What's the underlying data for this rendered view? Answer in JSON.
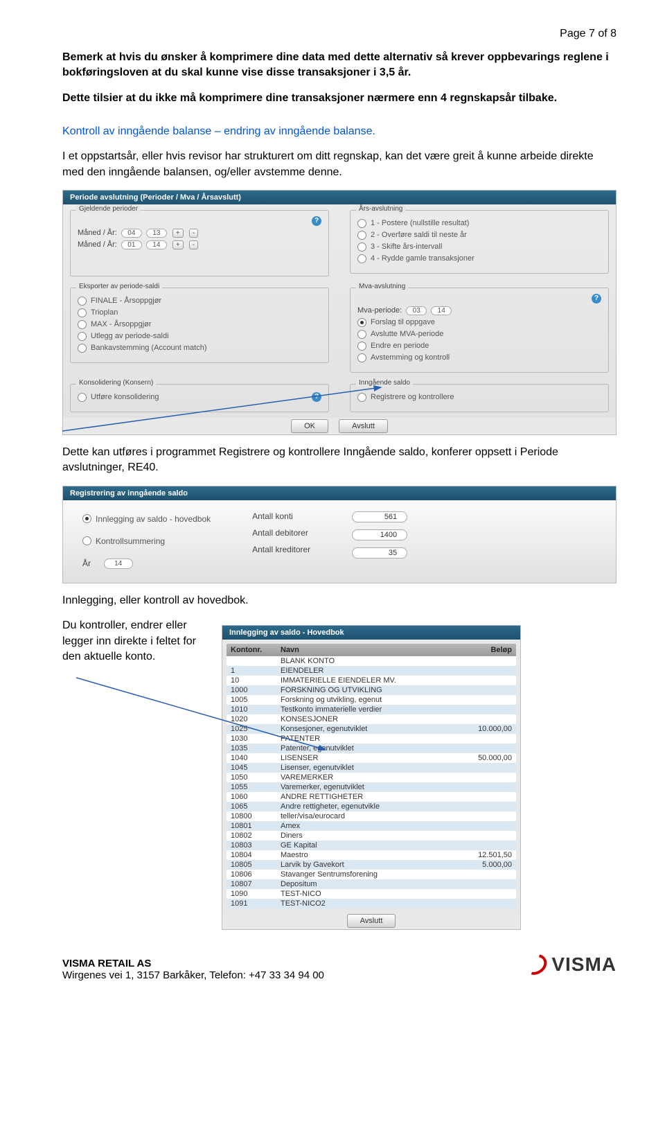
{
  "page_header": "Page 7 of 8",
  "intro1": "Bemerk at hvis du ønsker å komprimere dine data med dette alternativ så krever oppbevarings reglene i bokføringsloven at du skal kunne vise disse transaksjoner i 3,5 år.",
  "intro2": "Dette tilsier at du ikke må komprimere dine transaksjoner nærmere enn 4 regnskapsår tilbake.",
  "blue_heading": "Kontroll av inngående balanse – endring av inngående balanse.",
  "para1": "I et oppstartsår, eller hvis revisor har strukturert om ditt regnskap, kan det være greit å kunne arbeide direkte med den inngående balansen, og/eller avstemme denne.",
  "dlg1": {
    "title": "Periode avslutning (Perioder / Mva / Årsavslutt)",
    "gjeldende_label": "Gjeldende perioder",
    "maned_ar": "Måned / År:",
    "m1": "04",
    "y1": "13",
    "m2": "01",
    "y2": "14",
    "ars_label": "Års-avslutning",
    "ars_opts": [
      "1 - Postere (nullstille resultat)",
      "2 - Overføre saldi til neste år",
      "3 - Skifte års-intervall",
      "4 - Rydde gamle transaksjoner"
    ],
    "eksport_label": "Eksporter av periode-saldi",
    "eksport_opts": [
      "FINALE - Årsoppgjør",
      "Trioplan",
      "MAX - Årsoppgjør",
      "Utlegg av periode-saldi",
      "Bankavstemming (Account match)"
    ],
    "mva_label": "Mva-avslutning",
    "mva_periode": "Mva-periode:",
    "mva_m": "03",
    "mva_y": "14",
    "mva_opts": [
      "Forslag til oppgave",
      "Avslutte MVA-periode",
      "Endre en periode",
      "Avstemming og kontroll"
    ],
    "kons_label": "Konsolidering (Konsern)",
    "kons_opt": "Utføre konsolidering",
    "inng_label": "Inngående saldo",
    "inng_opt": "Registrere og kontrollere",
    "ok": "OK",
    "cancel": "Avslutt"
  },
  "para2": "Dette kan utføres i programmet Registrere og kontrollere Inngående saldo, konferer oppsett i Periode avslutninger, RE40.",
  "dlg2": {
    "title": "Registrering av inngående saldo",
    "opts": [
      "Innlegging av saldo - hovedbok",
      "Kontrollsummering"
    ],
    "ar_label": "År",
    "ar": "14",
    "antall_konti_label": "Antall konti",
    "antall_konti": "561",
    "antall_deb_label": "Antall debitorer",
    "antall_deb": "1400",
    "antall_kred_label": "Antall kreditorer",
    "antall_kred": "35"
  },
  "para3": "Innlegging, eller kontroll av hovedbok.",
  "para4": "Du kontroller, endrer eller legger inn direkte i feltet for den aktuelle konto.",
  "dlg3": {
    "title": "Innlegging av saldo - Hovedbok",
    "h1": "Kontonr.",
    "h2": "Navn",
    "h3": "Beløp",
    "rows": [
      {
        "n": "",
        "t": "BLANK KONTO",
        "b": ""
      },
      {
        "n": "1",
        "t": "EIENDELER",
        "b": ""
      },
      {
        "n": "10",
        "t": "IMMATERIELLE EIENDELER MV.",
        "b": ""
      },
      {
        "n": "1000",
        "t": "FORSKNING OG UTVIKLING",
        "b": ""
      },
      {
        "n": "1005",
        "t": "Forskning og utvikling, egenut",
        "b": ""
      },
      {
        "n": "1010",
        "t": "Testkonto immaterielle verdier",
        "b": ""
      },
      {
        "n": "1020",
        "t": "KONSESJONER",
        "b": ""
      },
      {
        "n": "1025",
        "t": "Konsesjoner, egenutviklet",
        "b": "10.000,00"
      },
      {
        "n": "1030",
        "t": "PATENTER",
        "b": ""
      },
      {
        "n": "1035",
        "t": "Patenter, egenutviklet",
        "b": ""
      },
      {
        "n": "1040",
        "t": "LISENSER",
        "b": "50.000,00"
      },
      {
        "n": "1045",
        "t": "Lisenser, egenutviklet",
        "b": ""
      },
      {
        "n": "1050",
        "t": "VAREMERKER",
        "b": ""
      },
      {
        "n": "1055",
        "t": "Varemerker, egenutviklet",
        "b": ""
      },
      {
        "n": "1060",
        "t": "ANDRE RETTIGHETER",
        "b": ""
      },
      {
        "n": "1065",
        "t": "Andre rettigheter, egenutvikle",
        "b": ""
      },
      {
        "n": "10800",
        "t": "teller/visa/eurocard",
        "b": ""
      },
      {
        "n": "10801",
        "t": "Amex",
        "b": ""
      },
      {
        "n": "10802",
        "t": "Diners",
        "b": ""
      },
      {
        "n": "10803",
        "t": "GE Kapital",
        "b": ""
      },
      {
        "n": "10804",
        "t": "Maestro",
        "b": "12.501,50"
      },
      {
        "n": "10805",
        "t": "Larvik by Gavekort",
        "b": "5.000,00"
      },
      {
        "n": "10806",
        "t": "Stavanger Sentrumsforening",
        "b": ""
      },
      {
        "n": "10807",
        "t": "Depositum",
        "b": ""
      },
      {
        "n": "1090",
        "t": "TEST-NICO",
        "b": ""
      },
      {
        "n": "1091",
        "t": "TEST-NICO2",
        "b": ""
      }
    ],
    "cancel": "Avslutt"
  },
  "footer": {
    "company": "VISMA RETAIL AS",
    "addr": "Wirgenes vei 1, 3157 Barkåker, Telefon: +47 33 34 94 00",
    "logo": "VISMA"
  }
}
